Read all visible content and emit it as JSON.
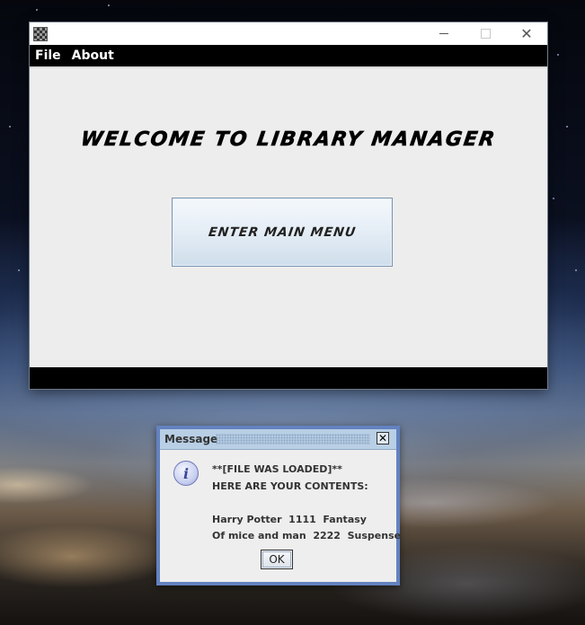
{
  "main_window": {
    "menu": {
      "file_label": "File",
      "about_label": "About"
    },
    "welcome_heading": "WELCOME TO LIBRARY MANAGER",
    "enter_button_label": "ENTER MAIN MENU"
  },
  "message_dialog": {
    "title": "Message",
    "icon": "info-icon",
    "lines": [
      "**[FILE WAS LOADED]**",
      "HERE ARE YOUR CONTENTS:",
      "",
      "Harry Potter  1111  Fantasy",
      "Of mice and man  2222  Suspense"
    ],
    "ok_label": "OK"
  },
  "colors": {
    "menubar_bg": "#000000",
    "dialog_border": "#6382bf",
    "dialog_titlebar": "#b8cfe5",
    "button_border": "#7a95b2"
  }
}
